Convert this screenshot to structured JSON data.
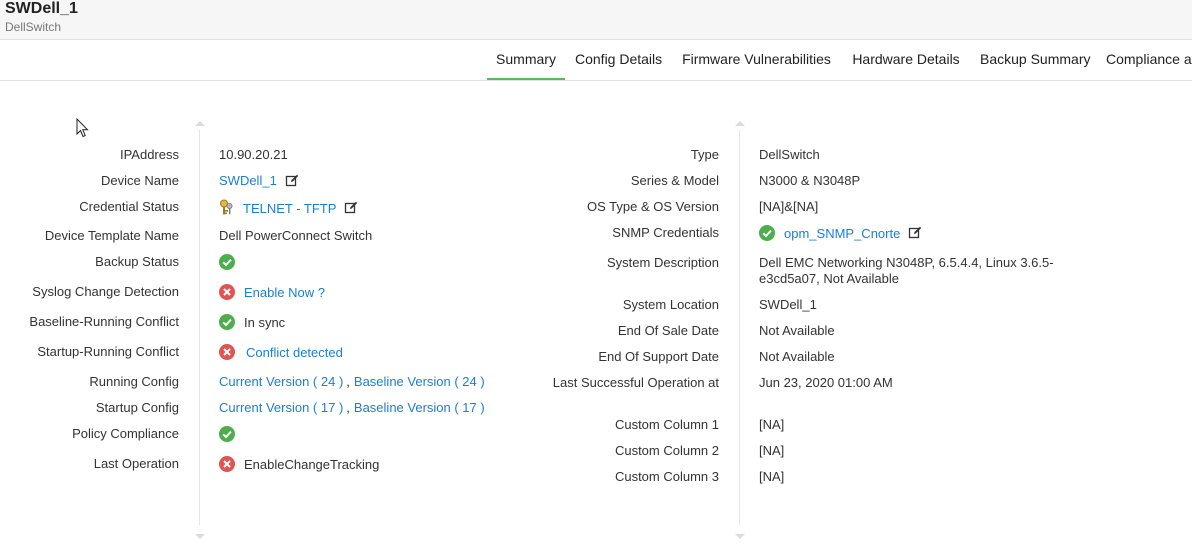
{
  "header": {
    "title": "SWDell_1",
    "subtitle": "DellSwitch"
  },
  "tabs": [
    {
      "label": "Summary",
      "active": true
    },
    {
      "label": "Config Details"
    },
    {
      "label": "Firmware Vulnerabilities"
    },
    {
      "label": "Hardware Details"
    },
    {
      "label": "Backup Summary"
    },
    {
      "label": "Compliance ar"
    }
  ],
  "left": {
    "ip_label": "IPAddress",
    "ip_value": "10.90.20.21",
    "device_name_label": "Device Name",
    "device_name_value": "SWDell_1",
    "credential_label": "Credential Status",
    "credential_value": "TELNET - TFTP",
    "template_label": "Device Template Name",
    "template_value": "Dell PowerConnect Switch",
    "backup_label": "Backup Status",
    "backup_status": "success",
    "syslog_label": "Syslog Change Detection",
    "syslog_value": "Enable Now ?",
    "baseline_label": "Baseline-Running Conflict",
    "baseline_value": "In sync",
    "startup_label": "Startup-Running Conflict",
    "startup_value": "Conflict detected",
    "running_label": "Running Config",
    "running_current": "Current Version ( 24 )",
    "running_sep": ",",
    "running_baseline": "Baseline Version ( 24 )",
    "startupcfg_label": "Startup Config",
    "startupcfg_current": "Current Version ( 17 )",
    "startupcfg_sep": ",",
    "startupcfg_baseline": "Baseline Version ( 17 )",
    "policy_label": "Policy Compliance",
    "policy_status": "success",
    "lastop_label": "Last Operation",
    "lastop_value": "EnableChangeTracking"
  },
  "right": {
    "type_label": "Type",
    "type_value": "DellSwitch",
    "series_label": "Series & Model",
    "series_value": "N3000 & N3048P",
    "os_label": "OS Type & OS Version",
    "os_value": "[NA]&[NA]",
    "snmp_label": "SNMP Credentials",
    "snmp_value": "opm_SNMP_Cnorte",
    "desc_label": "System Description",
    "desc_value": "Dell EMC Networking N3048P, 6.5.4.4, Linux 3.6.5-e3cd5a07, Not Available",
    "location_label": "System Location",
    "location_value": "SWDell_1",
    "eos_label": "End Of Sale Date",
    "eos_value": "Not Available",
    "eosupport_label": "End Of Support Date",
    "eosupport_value": "Not Available",
    "lastsucc_label": "Last Successful Operation at",
    "lastsucc_value": "Jun 23, 2020 01:00 AM",
    "cc1_label": "Custom Column 1",
    "cc1_value": "[NA]",
    "cc2_label": "Custom Column 2",
    "cc2_value": "[NA]",
    "cc3_label": "Custom Column 3",
    "cc3_value": "[NA]"
  },
  "colors": {
    "link": "#1a7fd4",
    "success": "#4cae4c",
    "error": "#e05454",
    "tab_active": "#5cb85c"
  },
  "icons": {
    "success": "check-circle-icon",
    "error": "x-circle-icon",
    "edit": "edit-icon",
    "credential": "keys-icon"
  }
}
